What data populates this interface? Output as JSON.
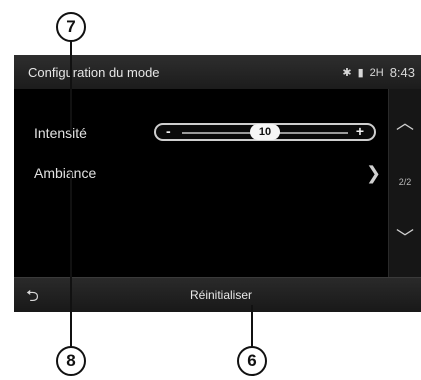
{
  "callouts": {
    "top": "7",
    "bottom_left": "8",
    "bottom_right": "6"
  },
  "statusbar": {
    "title": "Configuration du mode",
    "time": "8:43",
    "icons": [
      "bluetooth-icon",
      "signal-icon",
      "battery-icon"
    ],
    "signal_text": "2H"
  },
  "rows": {
    "intensity_label": "Intensité",
    "intensity_value": "10",
    "ambiance_label": "Ambiance"
  },
  "slider": {
    "minus": "-",
    "plus": "+"
  },
  "side": {
    "page_indicator": "2/2"
  },
  "bottombar": {
    "reset_label": "Réinitialiser"
  }
}
